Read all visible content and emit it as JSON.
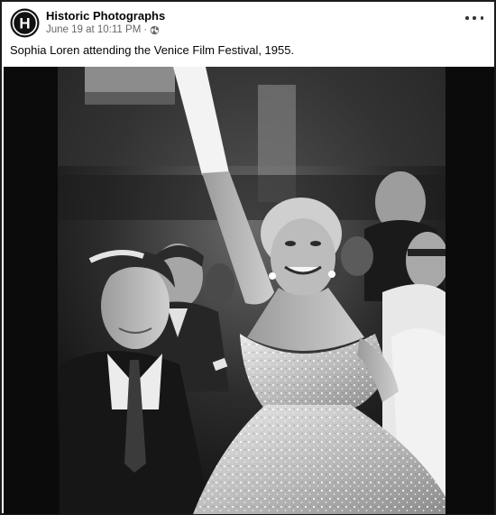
{
  "post": {
    "author": "Historic Photographs",
    "date": "June 19 at 10:11 PM",
    "separator": "·",
    "privacy_icon": "globe-icon",
    "avatar_letter": "H",
    "more_icon": "more-options-icon",
    "caption": "Sophia Loren attending the Venice Film Festival, 1955."
  },
  "photo": {
    "style": "black-and-white photograph"
  }
}
